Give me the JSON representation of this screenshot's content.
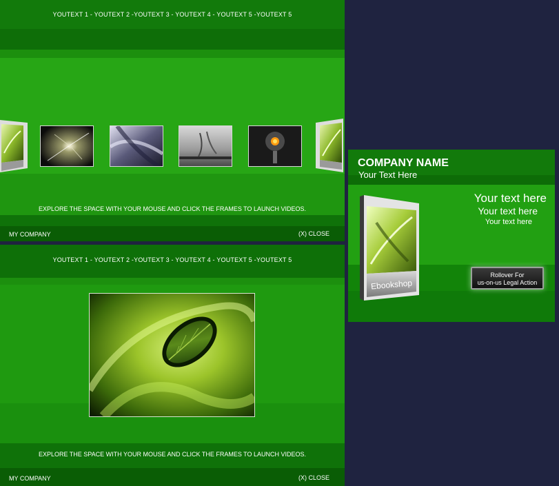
{
  "nav": {
    "text": "YOUTEXT 1 - YOUTEXT 2 -YOUTEXT 3 - YOUTEXT 4 - YOUTEXT 5 -YOUTEXT 5"
  },
  "panel": {
    "explore_text": "EXPLORE THE SPACE WITH YOUR MOUSE AND CLICK THE FRAMES TO LAUNCH VIDEOS.",
    "company_label": "MY COMPANY",
    "close_label": "(X) CLOSE"
  },
  "card": {
    "company_name": "COMPANY NAME",
    "subtitle": "Your Text Here",
    "text_large": "Your text here",
    "text_medium": "Your text here",
    "text_small": "Your text here",
    "box_label": "Ebookshop",
    "rollover_line1": "Rollover For",
    "rollover_line2": "us-on-us Legal Action"
  },
  "colors": {
    "background": "#1f2340",
    "green_main": "#1c8f0e",
    "green_light": "#27a615",
    "green_dark": "#0b6606"
  },
  "icons": [
    "ebook-box-icon",
    "orange-orb-icon"
  ]
}
